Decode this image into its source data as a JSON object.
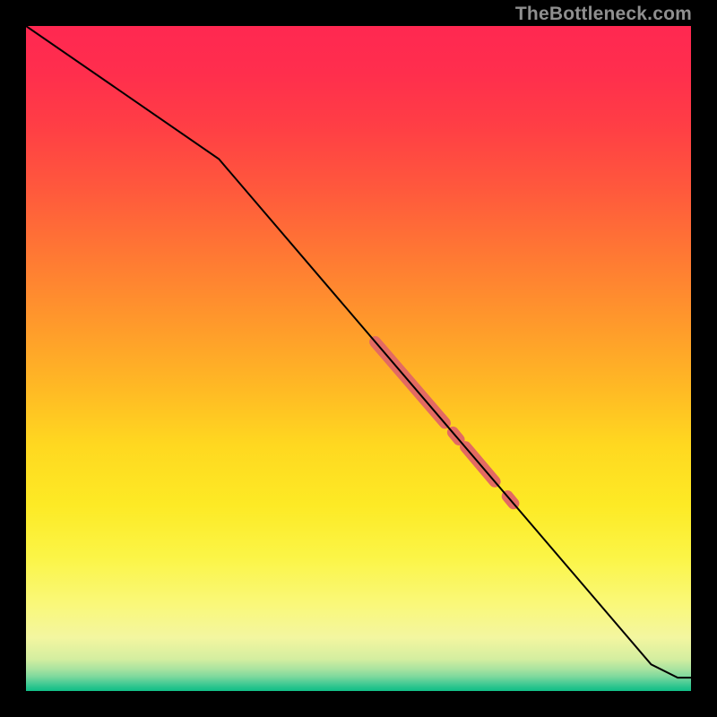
{
  "watermark": "TheBottleneck.com",
  "colors": {
    "bg_black": "#000000",
    "line": "#000000",
    "highlight": "#e36a62",
    "watermark": "#8f8f8f"
  },
  "chart_data": {
    "type": "line",
    "title": "",
    "xlabel": "",
    "ylabel": "",
    "xlim": [
      0,
      100
    ],
    "ylim": [
      0,
      100
    ],
    "grid": false,
    "line": {
      "x": [
        0,
        29,
        94,
        98,
        100
      ],
      "y": [
        100,
        80,
        4,
        2,
        2
      ]
    },
    "highlight_segments": [
      {
        "x": [
          52.5,
          63.0
        ],
        "y": [
          52.5,
          40.3
        ]
      },
      {
        "x": [
          64.2,
          65.1
        ],
        "y": [
          38.9,
          37.8
        ]
      },
      {
        "x": [
          66.1,
          70.5
        ],
        "y": [
          36.7,
          31.5
        ]
      },
      {
        "x": [
          72.4,
          73.3
        ],
        "y": [
          29.3,
          28.2
        ]
      }
    ],
    "background_gradient_stops": [
      {
        "offset": 0.0,
        "color": "#ff2851"
      },
      {
        "offset": 0.07,
        "color": "#ff2e4d"
      },
      {
        "offset": 0.15,
        "color": "#ff3e45"
      },
      {
        "offset": 0.25,
        "color": "#ff5a3c"
      },
      {
        "offset": 0.35,
        "color": "#ff7a33"
      },
      {
        "offset": 0.45,
        "color": "#ff9a2b"
      },
      {
        "offset": 0.55,
        "color": "#ffbb24"
      },
      {
        "offset": 0.63,
        "color": "#ffd820"
      },
      {
        "offset": 0.72,
        "color": "#fdea25"
      },
      {
        "offset": 0.8,
        "color": "#fbf547"
      },
      {
        "offset": 0.87,
        "color": "#faf87a"
      },
      {
        "offset": 0.92,
        "color": "#f3f6a0"
      },
      {
        "offset": 0.952,
        "color": "#d4eea0"
      },
      {
        "offset": 0.967,
        "color": "#a9e3a0"
      },
      {
        "offset": 0.978,
        "color": "#7fd99d"
      },
      {
        "offset": 0.987,
        "color": "#4fcd96"
      },
      {
        "offset": 0.994,
        "color": "#29c48d"
      },
      {
        "offset": 1.0,
        "color": "#11bf87"
      }
    ]
  }
}
